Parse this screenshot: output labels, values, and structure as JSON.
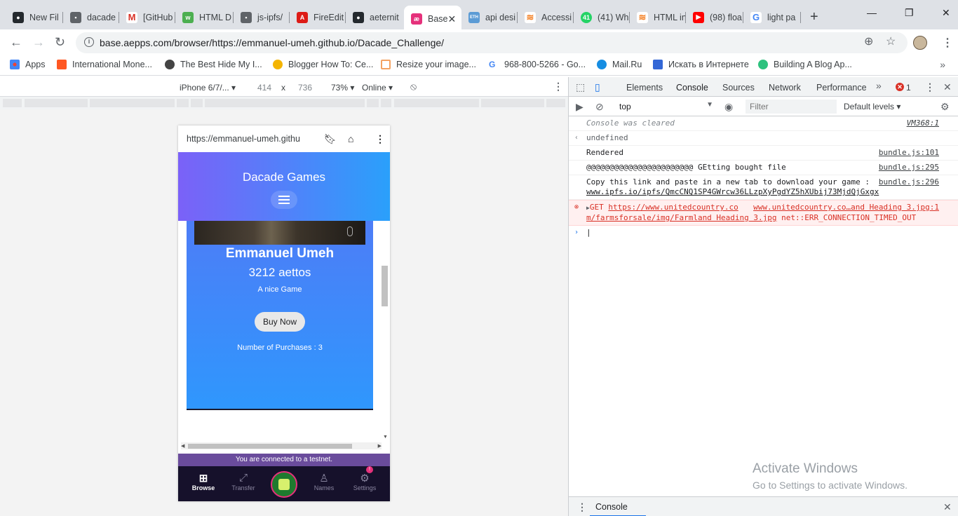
{
  "tabs": [
    {
      "label": "New Fil",
      "icon": "github-icon",
      "color": "#24292e"
    },
    {
      "label": "dacade",
      "icon": "folder-icon",
      "color": "#5f6368"
    },
    {
      "label": "[GitHub",
      "icon": "gmail-icon",
      "color": "#d93025"
    },
    {
      "label": "HTML D",
      "icon": "w3-icon",
      "color": "#4caf50"
    },
    {
      "label": "js-ipfs/",
      "icon": "folder-icon",
      "color": "#5f6368"
    },
    {
      "label": "FireEdit",
      "icon": "angular-icon",
      "color": "#dd1b16"
    },
    {
      "label": "aeternit",
      "icon": "github-icon",
      "color": "#24292e"
    },
    {
      "label": "Base",
      "icon": "aepp-icon",
      "color": "#e5317b"
    },
    {
      "label": "api desi",
      "icon": "eth-icon",
      "color": "#5b9bd5"
    },
    {
      "label": "Accessi",
      "icon": "stackoverflow-icon",
      "color": "#f48024"
    },
    {
      "label": "(41) Wh",
      "icon": "whatsapp-icon",
      "color": "#25d366"
    },
    {
      "label": "HTML in",
      "icon": "stackoverflow-icon",
      "color": "#f48024"
    },
    {
      "label": "(98) floa",
      "icon": "youtube-icon",
      "color": "#ff0000"
    },
    {
      "label": "light pa",
      "icon": "google-icon",
      "color": "#4285f4"
    }
  ],
  "active_tab": 7,
  "address": {
    "url": "base.aepps.com/browser/https://emmanuel-umeh.github.io/Dacade_Challenge/"
  },
  "bookmarks": [
    {
      "label": "Apps",
      "color": "#4285f4"
    },
    {
      "label": "International Mone...",
      "color": "#ff5722"
    },
    {
      "label": "The Best Hide My I...",
      "color": "#444444"
    },
    {
      "label": "Blogger How To: Ce...",
      "color": "#f4b400"
    },
    {
      "label": "Resize your image...",
      "color": "#f4a261"
    },
    {
      "label": "968-800-5266 - Go...",
      "color": "#4285f4"
    },
    {
      "label": "Mail.Ru",
      "color": "#168de2"
    },
    {
      "label": "Искать в Интернете",
      "color": "#3367d6"
    },
    {
      "label": "Building A Blog Ap...",
      "color": "#2ec27e"
    }
  ],
  "device": {
    "model": "iPhone 6/7/...",
    "width": "414",
    "times": "x",
    "height": "736",
    "zoom": "73%",
    "network": "Online"
  },
  "phone": {
    "url": "https://emmanuel-umeh.githu",
    "title": "Dacade Games",
    "card": {
      "name": "Emmanuel Umeh",
      "price": "3212 aettos",
      "description": "A nice Game",
      "buy_label": "Buy Now",
      "purchases": "Number of Purchases : 3"
    },
    "testnet": "You are connected to a testnet.",
    "nav": [
      {
        "label": "Browse",
        "icon": "grid-icon"
      },
      {
        "label": "Transfer",
        "icon": "transfer-icon"
      },
      {
        "label": "Names",
        "icon": "person-icon"
      },
      {
        "label": "Settings",
        "icon": "gear-icon"
      }
    ],
    "settings_badge": "!"
  },
  "devtools": {
    "tabs": [
      "Elements",
      "Console",
      "Sources",
      "Network",
      "Performance"
    ],
    "active_tab": "Console",
    "error_count": "1",
    "context": "top",
    "filter_placeholder": "Filter",
    "levels": "Default levels",
    "messages": [
      {
        "text": "Console was cleared",
        "source": "VM368:1",
        "type": "cleared"
      },
      {
        "text": "undefined",
        "source": "",
        "type": "result"
      },
      {
        "text": "Rendered",
        "source": "bundle.js:101",
        "type": "log"
      },
      {
        "text": "@@@@@@@@@@@@@@@@@@@@@@@ GEtting bought file",
        "source": "bundle.js:295",
        "type": "log"
      },
      {
        "text": "Copy this link and paste in a new tab to download your game :",
        "link": "www.ipfs.io/ipfs/QmcCNQ1SP4GWrcw36LLzpXyPgdYZ5hXUbij73MjdQjGxgx",
        "source": "bundle.js:296",
        "type": "log"
      },
      {
        "method": "GET",
        "url": "https://www.unitedcountry.co",
        "url2": "m/farmsforsale/img/Farmland Heading 3.jpg",
        "source": "www.unitedcountry.co…and Heading 3.jpg:1",
        "error": "net::ERR_CONNECTION_TIMED_OUT",
        "type": "error"
      }
    ],
    "drawer_tab": "Console"
  },
  "watermark": {
    "line1": "Activate Windows",
    "line2": "Go to Settings to activate Windows."
  }
}
